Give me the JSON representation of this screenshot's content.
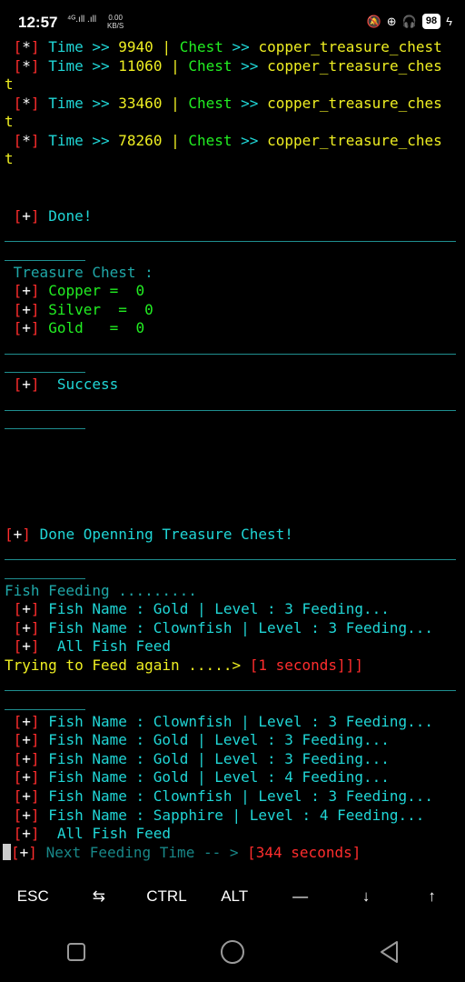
{
  "status": {
    "time": "12:57",
    "signal": "⁴ᴳ.ıll .ıll",
    "net_speed": "0.00",
    "net_unit": "KB/S",
    "battery": "98"
  },
  "lines": {
    "t1_time": "9940",
    "t1_chest": "copper_treasure_chest",
    "t2_time": "11060",
    "t2_chest": "copper_treasure_ches",
    "t2_wrap": "t",
    "t3_time": "33460",
    "t3_chest": "copper_treasure_ches",
    "t3_wrap": "t",
    "t4_time": "78260",
    "t4_chest": "copper_treasure_ches",
    "t4_wrap": "t",
    "time_label": "Time",
    "chest_label": "Chest",
    "done": "Done!",
    "treasure_title": "Treasure Chest :",
    "copper": "Copper =  0",
    "silver": "Silver  =  0",
    "gold": "Gold   =  0",
    "success": "Success",
    "done_opening": "Done Openning Treasure Chest!",
    "fish_feeding": "Fish Feeding .........",
    "f1": "Fish Name : Gold | Level : 3 Feeding...",
    "f2": "Fish Name : Clownfish | Level : 3 Feeding...",
    "all_fed": "All Fish Feed",
    "retry": "Trying to Feed again .....> ",
    "retry_secs": "[1 seconds]]]",
    "g1": "Fish Name : Clownfish | Level : 3 Feeding...",
    "g2": "Fish Name : Gold | Level : 3 Feeding...",
    "g3": "Fish Name : Gold | Level : 3 Feeding...",
    "g4": "Fish Name : Gold | Level : 4 Feeding...",
    "g5": "Fish Name : Clownfish | Level : 3 Feeding...",
    "g6": "Fish Name : Sapphire | Level : 4 Feeding...",
    "next": "Next Feeding Time -- > ",
    "next_secs": "[344 seconds]"
  },
  "keys": [
    "ESC",
    "⇆",
    "CTRL",
    "ALT",
    "—",
    "↓",
    "↑"
  ]
}
